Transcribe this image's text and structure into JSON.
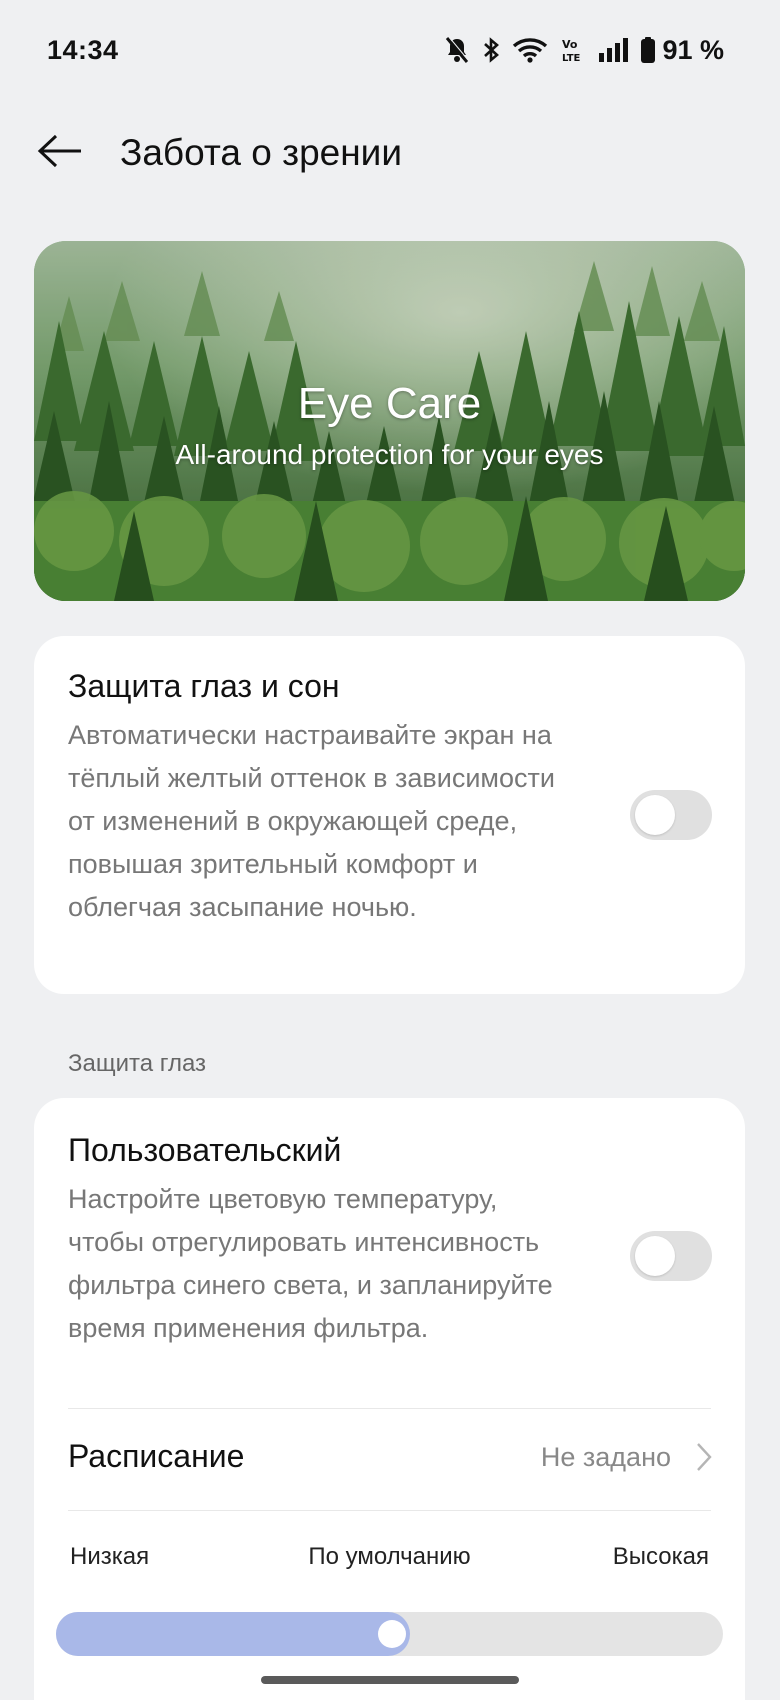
{
  "status_bar": {
    "time": "14:34",
    "battery_percent": "91 %",
    "icons": [
      "bell-off-icon",
      "bluetooth-icon",
      "wifi-icon",
      "volte-icon",
      "signal-icon",
      "battery-icon"
    ]
  },
  "app_bar": {
    "title": "Забота о зрении",
    "back_icon": "back-arrow-icon"
  },
  "hero": {
    "title": "Eye Care",
    "subtitle": "All-around protection for your eyes"
  },
  "sleep_card": {
    "title": "Защита глаз и сон",
    "description": "Автоматически настраивайте экран на тёплый желтый оттенок в зависимости от изменений в окружающей среде, повышая зрительный комфорт и облегчая засыпание ночью.",
    "toggle_on": false
  },
  "section": {
    "label": "Защита глаз"
  },
  "custom_card": {
    "title": "Пользовательский",
    "description": "Настройте цветовую температуру, чтобы отрегулировать интенсивность фильтра синего света, и запланируйте время применения фильтра.",
    "toggle_on": false,
    "schedule": {
      "label": "Расписание",
      "value": "Не задано"
    },
    "intensity": {
      "low_label": "Низкая",
      "default_label": "По умолчанию",
      "high_label": "Высокая",
      "value_percent": 53
    }
  },
  "colors": {
    "background": "#eff0f2",
    "card": "#ffffff",
    "slider_fill": "#a9b8e8",
    "toggle_off": "#e0e0e0"
  }
}
